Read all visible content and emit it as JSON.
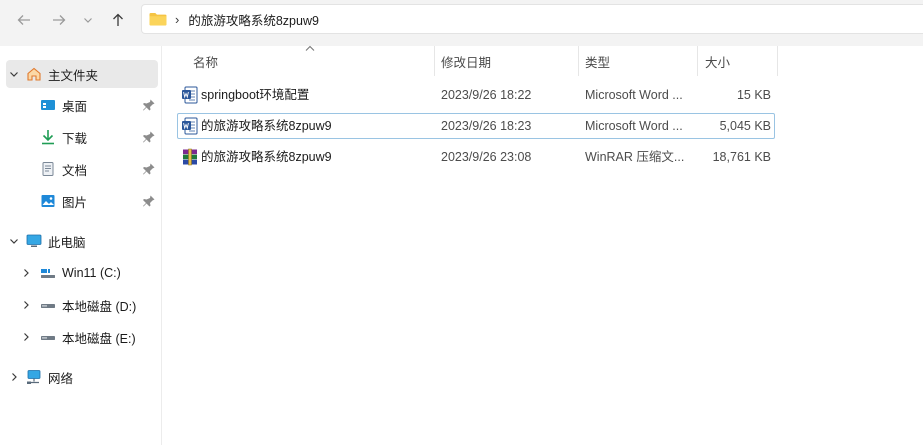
{
  "address_bar": {
    "breadcrumb": "的旅游攻略系统8zpuw9"
  },
  "sidebar": {
    "home": "主文件夹",
    "quick_access": [
      {
        "label": "桌面",
        "icon": "desktop-icon"
      },
      {
        "label": "下载",
        "icon": "download-icon"
      },
      {
        "label": "文档",
        "icon": "document-icon"
      },
      {
        "label": "图片",
        "icon": "picture-icon"
      }
    ],
    "this_pc": "此电脑",
    "drives": [
      {
        "label": "Win11 (C:)"
      },
      {
        "label": "本地磁盘 (D:)"
      },
      {
        "label": "本地磁盘 (E:)"
      }
    ],
    "network": "网络"
  },
  "columns": {
    "name": "名称",
    "date": "修改日期",
    "type": "类型",
    "size": "大小"
  },
  "files": [
    {
      "name": "springboot环境配置",
      "date": "2023/9/26 18:22",
      "type": "Microsoft Word ...",
      "size": "15 KB",
      "icon": "word-document-icon"
    },
    {
      "name": "的旅游攻略系统8zpuw9",
      "date": "2023/9/26 18:23",
      "type": "Microsoft Word ...",
      "size": "5,045 KB",
      "icon": "word-document-icon"
    },
    {
      "name": "的旅游攻略系统8zpuw9",
      "date": "2023/9/26 23:08",
      "type": "WinRAR 压缩文...",
      "size": "18,761 KB",
      "icon": "winrar-archive-icon"
    }
  ],
  "colors": {
    "accent": "#0067c0",
    "folder": "#f5c443",
    "selection_border": "#9ac4e3"
  }
}
